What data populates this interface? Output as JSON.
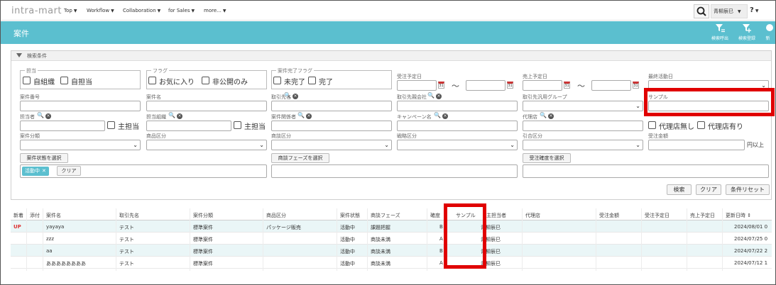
{
  "app": {
    "logo": "intra-mart",
    "menu": [
      "Top",
      "Workflow",
      "Collaboration",
      "for Sales",
      "more..."
    ],
    "user_name": "青柳辰巳",
    "help_label": "?"
  },
  "page": {
    "title": "案件",
    "toolbar": [
      "検索呼出",
      "検索登録",
      "新"
    ]
  },
  "search": {
    "panel_title": "検索条件",
    "tantou": {
      "legend": "担当",
      "options": [
        "自組織",
        "自担当"
      ]
    },
    "flag": {
      "legend": "フラグ",
      "options": [
        "お気に入り",
        "非公開のみ"
      ]
    },
    "kanryo": {
      "legend": "案件完了フラグ",
      "options": [
        "未完了",
        "完了"
      ]
    },
    "juchu_yotei_label": "受注予定日",
    "uriage_yotei_label": "売上予定日",
    "saishu_label": "最終活動日",
    "calendar_day": "31",
    "tilde": "〜",
    "anken_bango_label": "案件番号",
    "anken_mei_label": "案件名",
    "torihikisaki_label": "取引先名",
    "torihiki_kaisha_label": "取引先親会社",
    "torihiki_group_label": "取引先汎用グループ",
    "sample_label": "サンプル",
    "tantousha_label": "担当者",
    "tantou_soshiki_label": "担当組織",
    "kankei_label": "案件関係者",
    "campaign_label": "キャンペーン名",
    "dairiten_label": "代理店",
    "shutantou": "主担当",
    "dairiten_nashi": "代理店無し",
    "dairiten_ari": "代理店有り",
    "bunrui_label": "案件分類",
    "shohin_label": "商品区分",
    "shodan_kubun_label": "商談区分",
    "senryaku_label": "戦略区分",
    "hikiai_label": "引合区分",
    "kingaku_label": "受注金額",
    "kingaku_unit": "円以上",
    "status_btn": "案件状態を選択",
    "phase_btn": "商談フェーズを選択",
    "kakudo_btn": "受注確度を選択",
    "status_tag": "活動中",
    "tag_x": "✕",
    "clear_small": "クリア",
    "btn_search": "検索",
    "btn_clear": "クリア",
    "btn_reset": "条件リセット"
  },
  "table": {
    "headers": [
      "新着",
      "添付",
      "案件名",
      "取引先名",
      "案件分類",
      "商品区分",
      "案件状態",
      "商談フェーズ",
      "確度",
      "サンプル",
      "主担当者",
      "代理店",
      "受注金額",
      "受注予定日",
      "売上予定日",
      "更新日時"
    ],
    "sort_icon": "⇕",
    "rows": [
      {
        "new": "UP",
        "name": "yayaya",
        "client": "テスト",
        "class": "標準案件",
        "product": "パッケージ販売",
        "status": "活動中",
        "phase": "課題把握",
        "rank": "B",
        "owner": "青柳辰巳",
        "updated": "2024/08/01 0"
      },
      {
        "new": "",
        "name": "zzz",
        "client": "テスト",
        "class": "標準案件",
        "product": "",
        "status": "活動中",
        "phase": "商談未満",
        "rank": "A",
        "owner": "青柳辰巳",
        "updated": "2024/07/25 0"
      },
      {
        "new": "",
        "name": "aa",
        "client": "テスト",
        "class": "標準案件",
        "product": "",
        "status": "活動中",
        "phase": "商談未満",
        "rank": "B",
        "owner": "青柳辰巳",
        "updated": "2024/07/22 2"
      },
      {
        "new": "",
        "name": "ああああああああ",
        "client": "テスト",
        "class": "標準案件",
        "product": "",
        "status": "活動中",
        "phase": "商談未満",
        "rank": "A",
        "owner": "青柳辰巳",
        "updated": "2024/07/12 1"
      }
    ]
  },
  "colors": {
    "accent": "#5bbfcf",
    "highlight": "#e00000",
    "new_badge": "#dd3333"
  }
}
